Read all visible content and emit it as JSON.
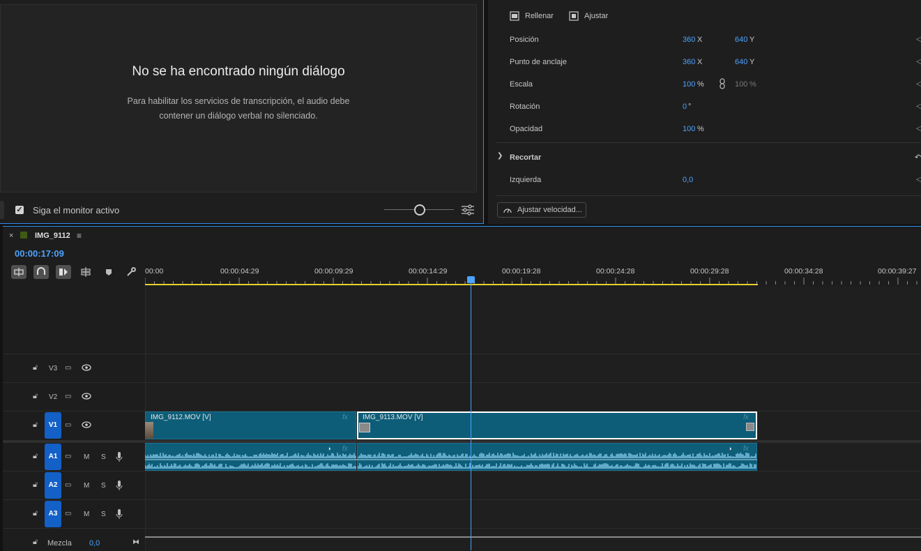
{
  "transcript": {
    "title": "No se ha encontrado ningún diálogo",
    "desc_line1": "Para habilitar los servicios de transcripción, el audio debe",
    "desc_line2": "contener un diálogo verbal no silenciado.",
    "follow_monitor_label": "Siga el monitor activo",
    "follow_checked": true
  },
  "effects": {
    "fill_label": "Rellenar",
    "fit_label": "Ajustar",
    "rows": [
      {
        "label": "Posición",
        "x": "360",
        "x_unit": "X",
        "y": "640",
        "y_unit": "Y"
      },
      {
        "label": "Punto de anclaje",
        "x": "360",
        "x_unit": "X",
        "y": "640",
        "y_unit": "Y"
      },
      {
        "label": "Escala",
        "x": "100",
        "x_unit": "%",
        "y": "100",
        "y_unit": "%"
      },
      {
        "label": "Rotación",
        "x": "0",
        "x_unit": "°"
      },
      {
        "label": "Opacidad",
        "x": "100",
        "x_unit": "%"
      }
    ],
    "crop_section": "Recortar",
    "crop_left_label": "Izquierda",
    "crop_left_value": "0,0",
    "speed_button": "Ajustar velocidad..."
  },
  "timeline": {
    "sequence_name": "IMG_9112",
    "timecode": "00:00:17:09",
    "ruler": [
      "00:00",
      "00:00:04:29",
      "00:00:09:29",
      "00:00:14:29",
      "00:00:19:28",
      "00:00:24:28",
      "00:00:29:28",
      "00:00:34:28",
      "00:00:39:27"
    ],
    "video_tracks": [
      "V3",
      "V2",
      "V1"
    ],
    "audio_tracks": [
      "A1",
      "A2",
      "A3"
    ],
    "mute_label": "M",
    "solo_label": "S",
    "clips": {
      "v1_a": "IMG_9112.MOV [V]",
      "v1_b": "IMG_9113.MOV [V]",
      "fx": "fx"
    },
    "mix_label": "Mezcla",
    "mix_value": "0,0"
  },
  "colors": {
    "accent": "#4da3ff",
    "clip": "#0d5d78",
    "track_badge": "#1360c7",
    "work_area": "#e6d12e"
  }
}
